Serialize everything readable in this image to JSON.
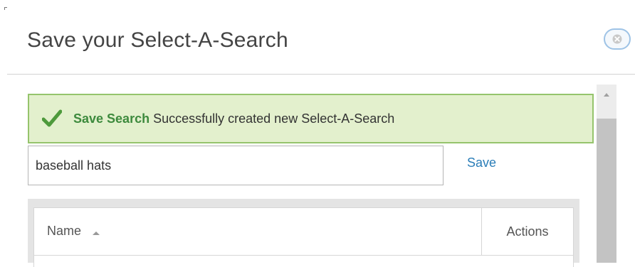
{
  "dialog": {
    "title": "Save your Select-A-Search",
    "close_icon": "close-icon"
  },
  "alert": {
    "icon": "checkmark-icon",
    "title": "Save Search",
    "message": "Successfully created new Select-A-Search",
    "background": "#e3f0cd",
    "border": "#95c46c",
    "title_color": "#3d8a3d"
  },
  "form": {
    "search_name_value": "baseball hats",
    "save_label": "Save",
    "link_color": "#2a7db8"
  },
  "table": {
    "columns": {
      "name": "Name",
      "actions": "Actions"
    },
    "sort_icon": "sort-ascending-icon"
  }
}
